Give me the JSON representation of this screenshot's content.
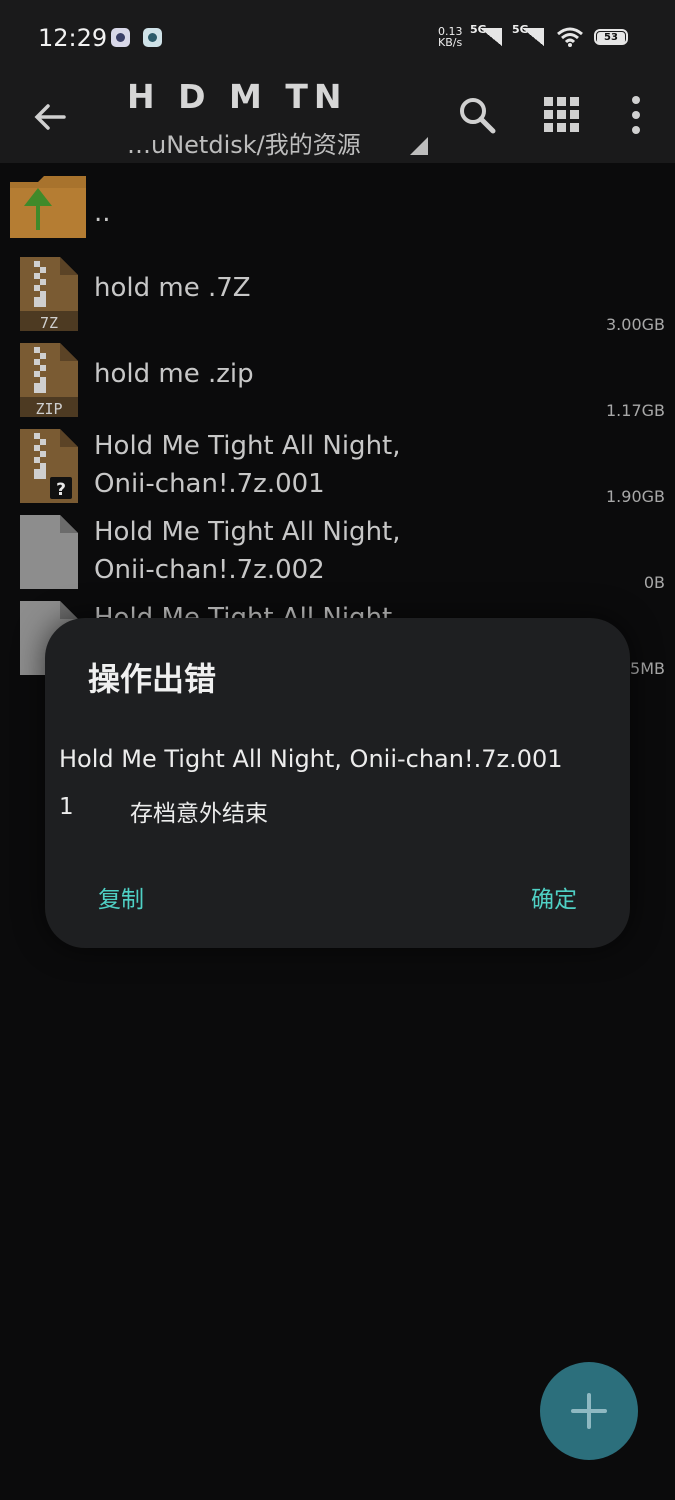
{
  "status_bar": {
    "time": "12:29",
    "net_speed_value": "0.13",
    "net_speed_unit": "KB/s",
    "signal1_label": "5G",
    "signal2_label": "5G",
    "battery": "53"
  },
  "toolbar": {
    "title": "H D M TN",
    "path": "…uNetdisk/我的资源",
    "icons": [
      "back-arrow-icon",
      "search-icon",
      "grid-view-icon",
      "more-vert-icon"
    ]
  },
  "files": [
    {
      "name_line1": "..",
      "name_line2": "",
      "size": "",
      "type": "parent-folder"
    },
    {
      "name_line1": "hold me .7Z",
      "name_line2": "",
      "size": "3.00GB",
      "type": "7z"
    },
    {
      "name_line1": "hold me .zip",
      "name_line2": "",
      "size": "1.17GB",
      "type": "zip"
    },
    {
      "name_line1": "Hold Me Tight All Night,",
      "name_line2": "Onii-chan!.7z.001",
      "size": "1.90GB",
      "type": "unknown-archive"
    },
    {
      "name_line1": "Hold Me Tight All Night,",
      "name_line2": "Onii-chan!.7z.002",
      "size": "0B",
      "type": "file"
    },
    {
      "name_line1": "Hold Me Tight All Night,",
      "name_line2": "",
      "size": "5MB",
      "type": "file"
    }
  ],
  "dialog": {
    "title": "操作出错",
    "message": "Hold Me Tight All Night, Onii-chan!.7z.001",
    "error_code": "1",
    "error_detail": "存档意外结束",
    "copy_label": "复制",
    "ok_label": "确定"
  },
  "colors": {
    "accent": "#4fd1c5",
    "fab": "#2c6f7c",
    "archive_icon": "#8a6a3c"
  }
}
